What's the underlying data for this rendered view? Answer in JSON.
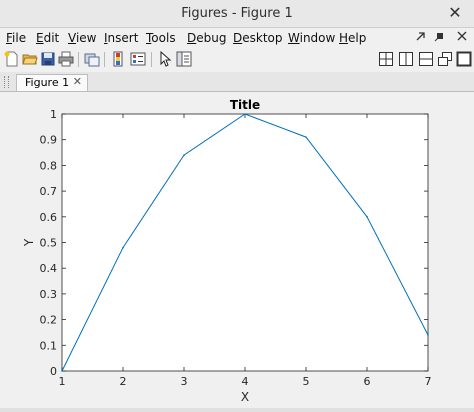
{
  "window": {
    "title": "Figures - Figure 1",
    "close_glyph": "✕"
  },
  "menu": {
    "items": [
      {
        "first": "F",
        "rest": "ile"
      },
      {
        "first": "E",
        "rest": "dit"
      },
      {
        "first": "V",
        "rest": "iew"
      },
      {
        "first": "I",
        "rest": "nsert"
      },
      {
        "first": "T",
        "rest": "ools"
      },
      {
        "first": "D",
        "rest": "ebug"
      },
      {
        "first": "D",
        "rest": "esktop"
      },
      {
        "first": "W",
        "rest": "indow"
      },
      {
        "first": "H",
        "rest": "elp"
      }
    ]
  },
  "tab": {
    "label": "Figure 1",
    "close_glyph": "✕"
  },
  "colors": {
    "line": "#0072bd",
    "axes": "#262626"
  },
  "chart_data": {
    "type": "line",
    "title": "Title",
    "xlabel": "X",
    "ylabel": "Y",
    "xlim": [
      1,
      7
    ],
    "ylim": [
      0,
      1
    ],
    "xticks": [
      "1",
      "2",
      "3",
      "4",
      "5",
      "6",
      "7"
    ],
    "yticks": [
      "0",
      "0.1",
      "0.2",
      "0.3",
      "0.4",
      "0.5",
      "0.6",
      "0.7",
      "0.8",
      "0.9",
      "1"
    ],
    "grid": false,
    "x": [
      1,
      2,
      3,
      4,
      5,
      6,
      7
    ],
    "y": [
      0,
      0.48,
      0.84,
      1.0,
      0.91,
      0.6,
      0.14
    ]
  }
}
